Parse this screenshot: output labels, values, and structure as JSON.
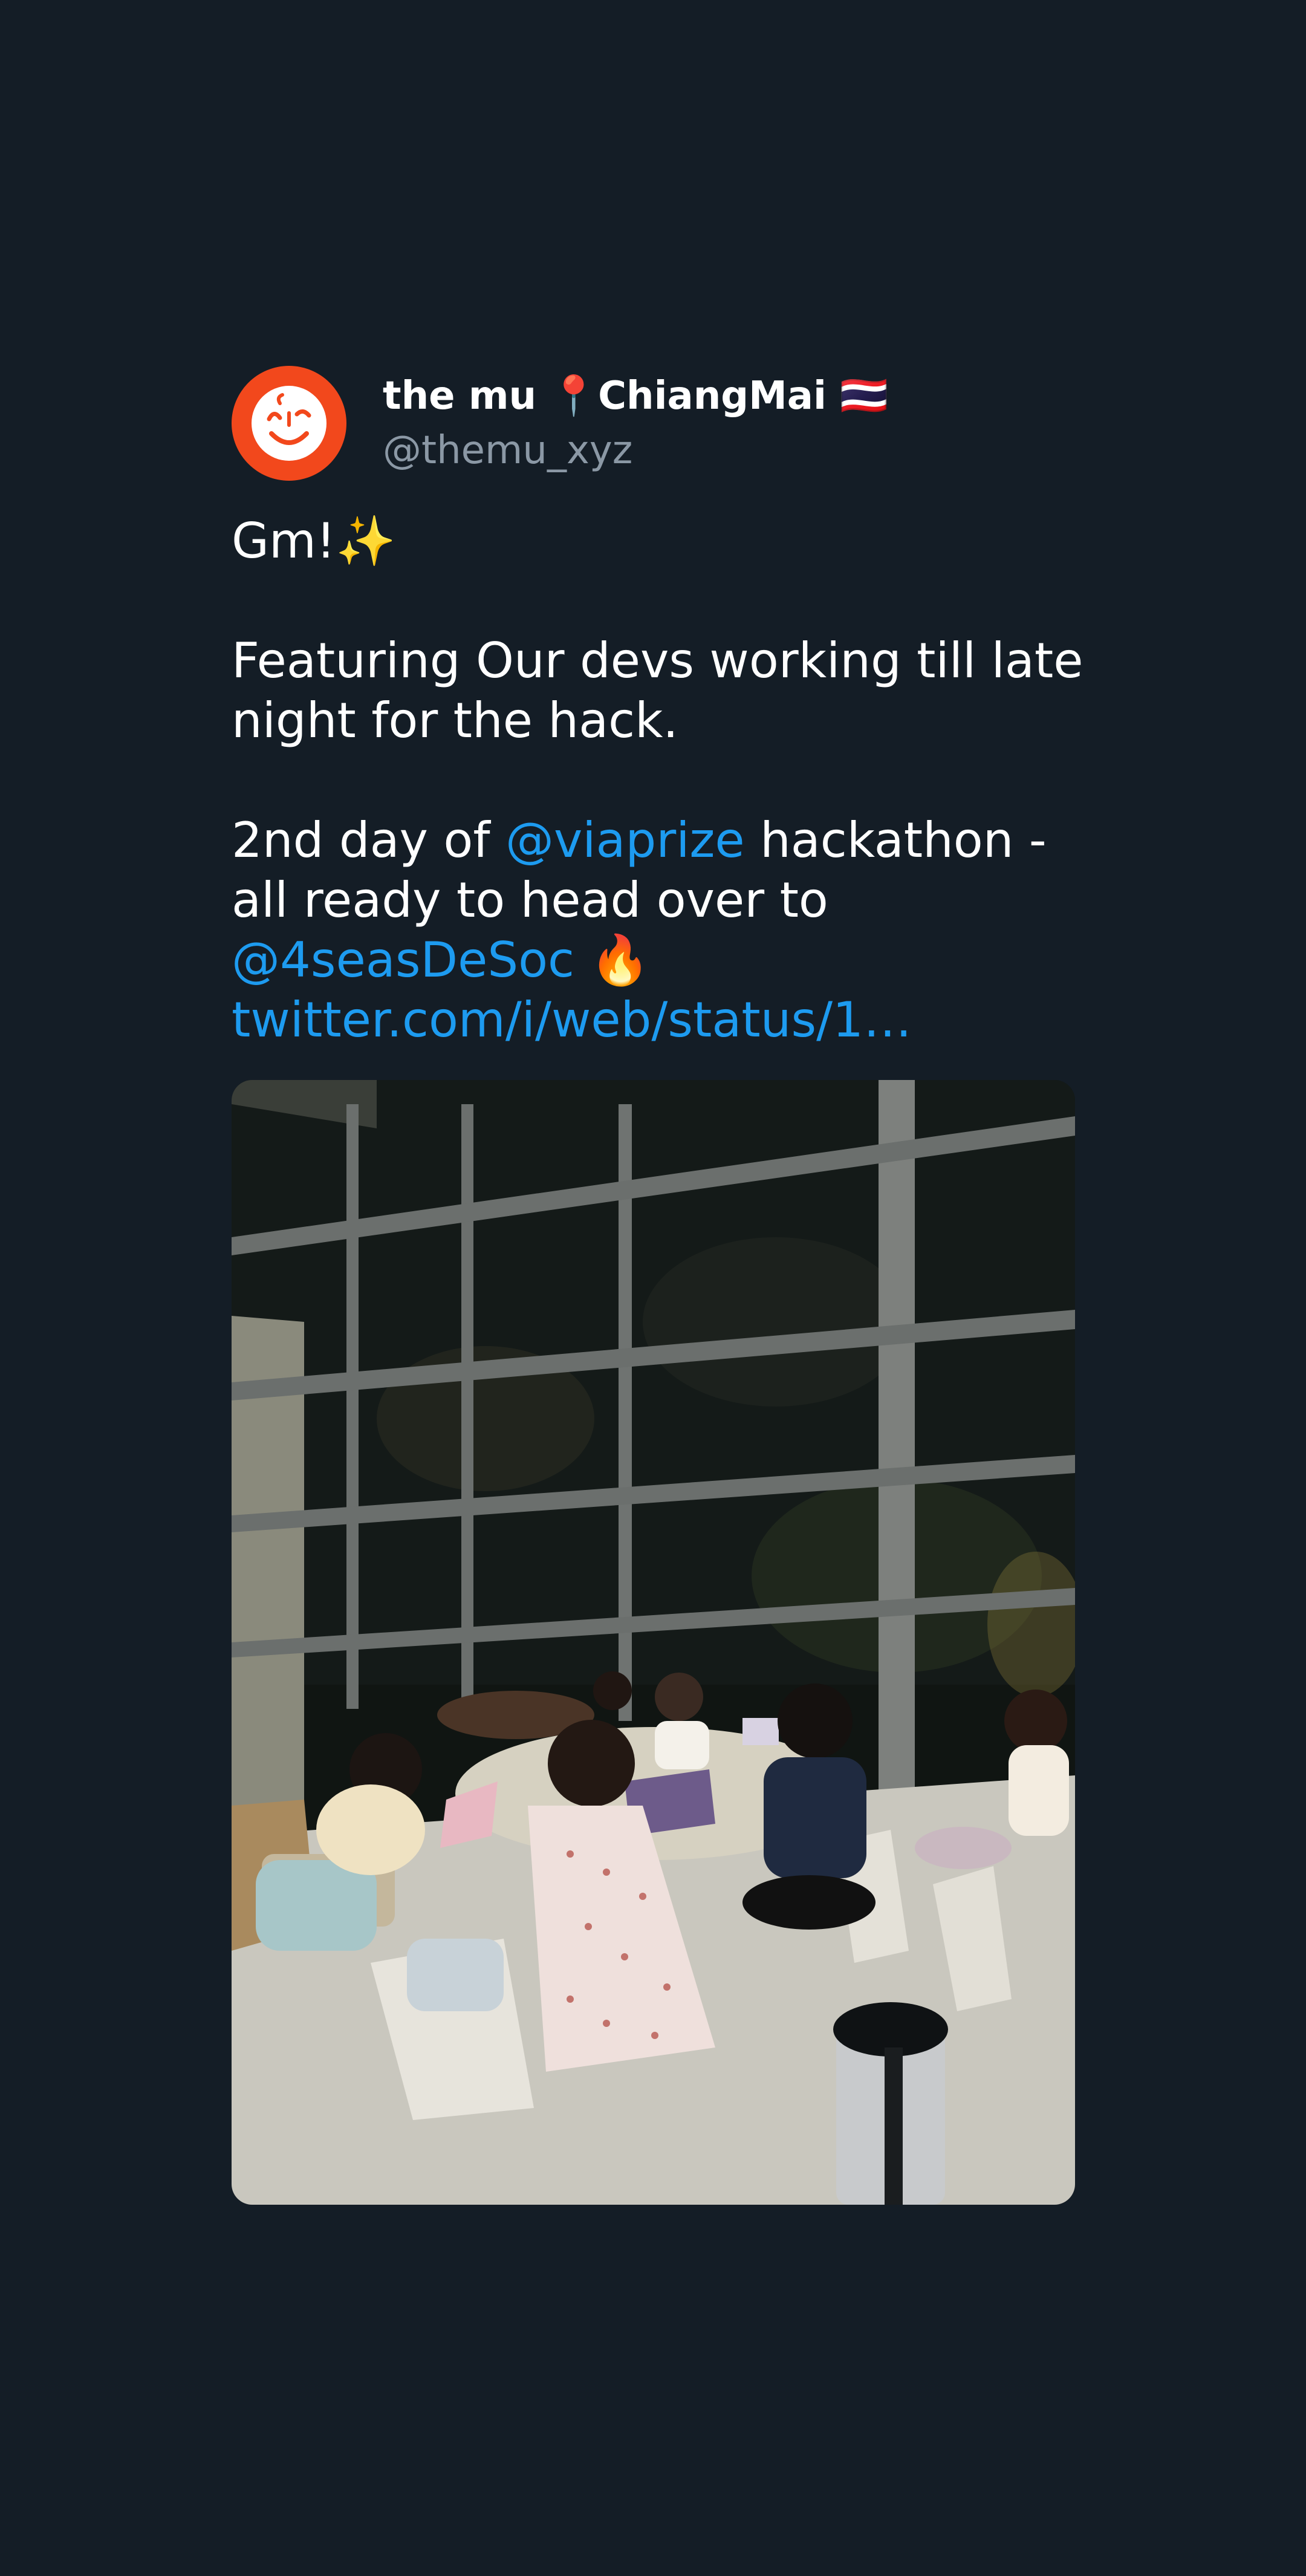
{
  "tweet": {
    "display_name": "the mu 📍ChiangMai 🇹🇭",
    "handle": "@themu_xyz",
    "greeting": "Gm!✨",
    "line1": "Featuring Our devs working till late",
    "line2": "night for the hack.",
    "line3_prefix": "2nd day of ",
    "mention1": "@viaprize",
    "line3_suffix": " hackathon -",
    "line4": "all ready to head over to",
    "mention2": "@4seasDeSoc",
    "fire_emoji": " 🔥",
    "status_link": "twitter.com/i/web/status/1…"
  },
  "colors": {
    "background": "#141d26",
    "link": "#1d9bf0",
    "handle": "#8b98a5",
    "avatar": "#f2481c"
  },
  "icons": {
    "avatar": "smiling-face-logo-icon"
  },
  "media": {
    "alt_description": "Photo of developers working at a table late at night in a glass-walled room"
  }
}
